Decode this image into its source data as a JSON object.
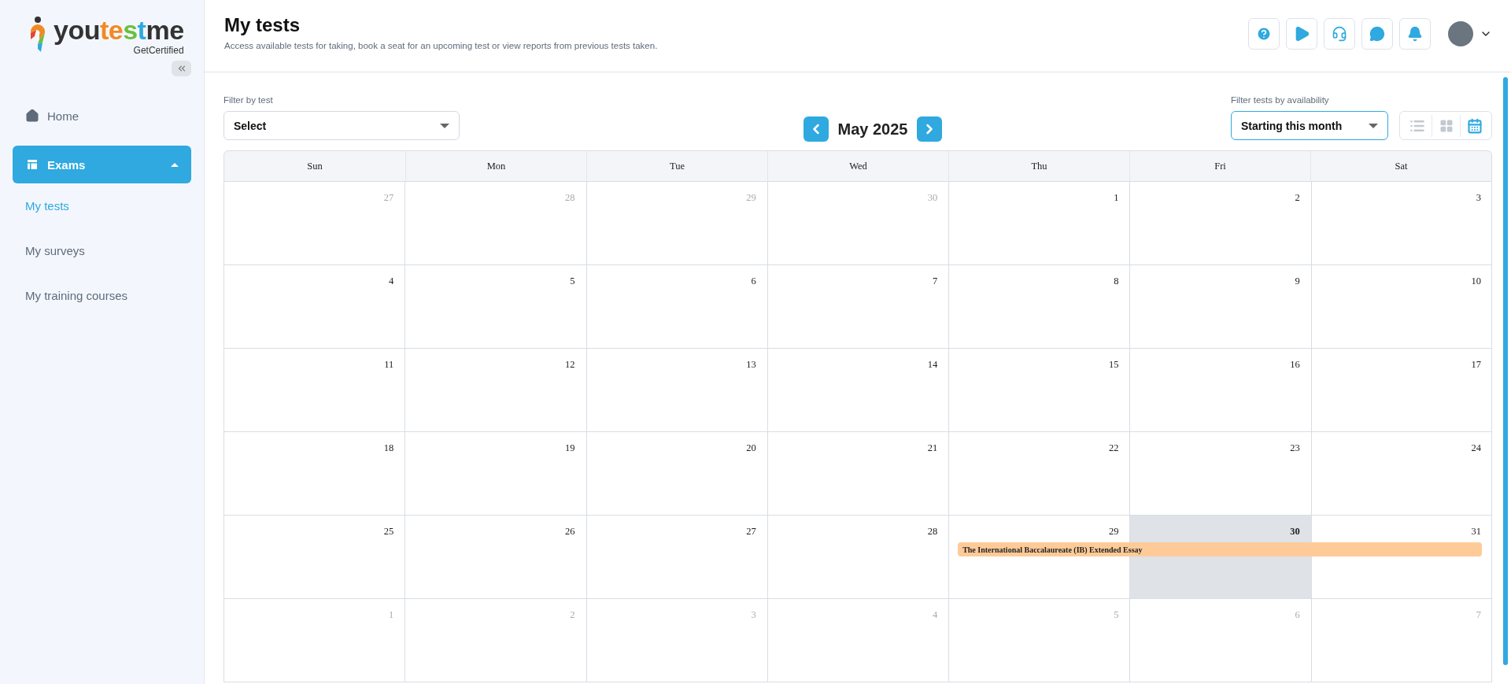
{
  "sidebar": {
    "logo": {
      "parts": [
        {
          "text": "you",
          "color": "#333333"
        },
        {
          "text": "te",
          "color": "#f08a24"
        },
        {
          "text": "s",
          "color": "#6cbf3e"
        },
        {
          "text": "t",
          "color": "#2fa9df"
        },
        {
          "text": "me",
          "color": "#333333"
        }
      ],
      "tagline": "GetCertified"
    },
    "items": [
      {
        "label": "Home",
        "kind": "home",
        "selected": false
      },
      {
        "label": "Exams",
        "kind": "group",
        "selected": true,
        "expanded": true,
        "children": [
          {
            "label": "My tests",
            "selected": true
          },
          {
            "label": "My surveys",
            "selected": false
          },
          {
            "label": "My training courses",
            "selected": false
          }
        ]
      }
    ]
  },
  "header": {
    "title": "My tests",
    "subtitle": "Access available tests for taking, book a seat for an upcoming test or view reports from previous tests taken.",
    "actions": [
      {
        "kind": "help"
      },
      {
        "kind": "play"
      },
      {
        "kind": "support"
      },
      {
        "kind": "chat"
      },
      {
        "kind": "bell"
      }
    ]
  },
  "filters": {
    "test": {
      "label": "Filter by test",
      "value": "Select"
    },
    "availability": {
      "label": "Filter tests by availability",
      "value": "Starting this month"
    },
    "views": [
      {
        "kind": "list",
        "selected": false
      },
      {
        "kind": "grid",
        "selected": false
      },
      {
        "kind": "calendar",
        "selected": true
      }
    ]
  },
  "calendar": {
    "month": "May 2025",
    "weekdays": [
      "Sun",
      "Mon",
      "Tue",
      "Wed",
      "Thu",
      "Fri",
      "Sat"
    ],
    "weeks": [
      {
        "days": [
          {
            "label": "27",
            "muted": true
          },
          {
            "label": "28",
            "muted": true
          },
          {
            "label": "29",
            "muted": true
          },
          {
            "label": "30",
            "muted": true
          },
          {
            "label": "1",
            "muted": false
          },
          {
            "label": "2",
            "muted": false
          },
          {
            "label": "3",
            "muted": false
          }
        ]
      },
      {
        "days": [
          {
            "label": "4",
            "muted": false
          },
          {
            "label": "5",
            "muted": false
          },
          {
            "label": "6",
            "muted": false
          },
          {
            "label": "7",
            "muted": false
          },
          {
            "label": "8",
            "muted": false
          },
          {
            "label": "9",
            "muted": false
          },
          {
            "label": "10",
            "muted": false
          }
        ]
      },
      {
        "days": [
          {
            "label": "11",
            "muted": false
          },
          {
            "label": "12",
            "muted": false
          },
          {
            "label": "13",
            "muted": false
          },
          {
            "label": "14",
            "muted": false
          },
          {
            "label": "15",
            "muted": false
          },
          {
            "label": "16",
            "muted": false
          },
          {
            "label": "17",
            "muted": false
          }
        ]
      },
      {
        "days": [
          {
            "label": "18",
            "muted": false
          },
          {
            "label": "19",
            "muted": false
          },
          {
            "label": "20",
            "muted": false
          },
          {
            "label": "21",
            "muted": false
          },
          {
            "label": "22",
            "muted": false
          },
          {
            "label": "23",
            "muted": false
          },
          {
            "label": "24",
            "muted": false
          }
        ]
      },
      {
        "days": [
          {
            "label": "25",
            "muted": false
          },
          {
            "label": "26",
            "muted": false
          },
          {
            "label": "27",
            "muted": false
          },
          {
            "label": "28",
            "muted": false
          },
          {
            "label": "29",
            "muted": false,
            "events": [
              {
                "title": "The International Baccalaureate (IB) Extended Essay",
                "color": "#fecb98"
              }
            ]
          },
          {
            "label": "30",
            "muted": false,
            "today": true
          },
          {
            "label": "31",
            "muted": false
          }
        ]
      },
      {
        "days": [
          {
            "label": "1",
            "muted": true
          },
          {
            "label": "2",
            "muted": true
          },
          {
            "label": "3",
            "muted": true
          },
          {
            "label": "4",
            "muted": true
          },
          {
            "label": "5",
            "muted": true
          },
          {
            "label": "6",
            "muted": true
          },
          {
            "label": "7",
            "muted": true
          }
        ]
      }
    ]
  }
}
